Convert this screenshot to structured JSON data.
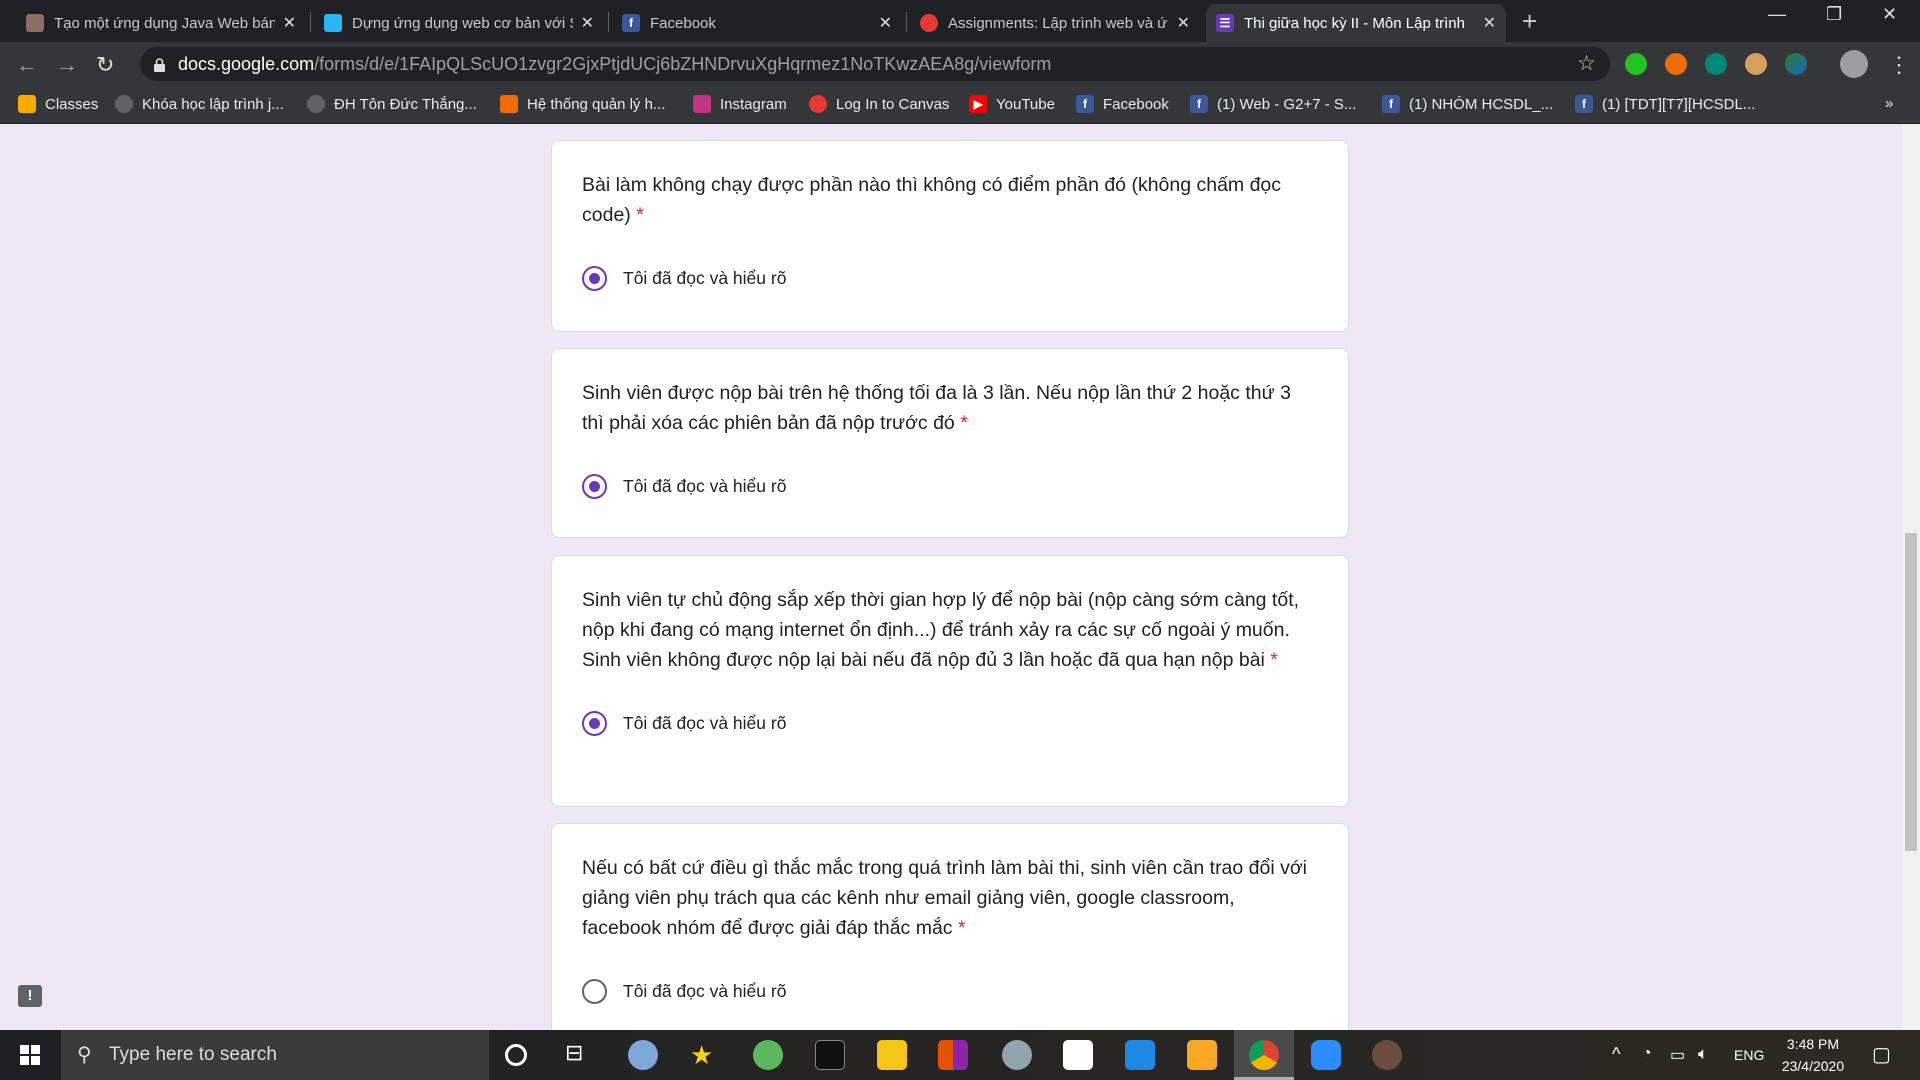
{
  "browser": {
    "tabs": [
      {
        "title": "Tạo một ứng dụng Java Web bán",
        "icon": "user-avatar-icon",
        "color": "#8d6e63",
        "active": false
      },
      {
        "title": "Dựng ứng dụng web cơ bản với S",
        "icon": "pin-icon",
        "color": "#29b6f6",
        "active": false
      },
      {
        "title": "Facebook",
        "icon": "facebook-icon",
        "color": "#3b5998",
        "active": false
      },
      {
        "title": "Assignments: Lập trình web và ứ",
        "icon": "canvas-icon",
        "color": "#e53935",
        "active": false
      },
      {
        "title": "Thi giữa học kỳ II - Môn Lập trình",
        "icon": "google-forms-icon",
        "color": "#673ab7",
        "active": true
      }
    ],
    "url_host": "docs.google.com",
    "url_path": "/forms/d/e/1FAIpQLScUO1zvgr2GjxPtjdUCj6bZHNDrvuXgHqrmez1NoTKwzAEA8g/viewform",
    "bookmarks": [
      {
        "label": "Classes",
        "icon": "classroom-icon",
        "color": "#f9ab00"
      },
      {
        "label": "Khóa học lập trình j...",
        "icon": "globe-icon",
        "color": "#5f6368"
      },
      {
        "label": "ĐH Tôn Đức Thắng...",
        "icon": "globe-icon",
        "color": "#5f6368"
      },
      {
        "label": "Hệ thống quản lý h...",
        "icon": "chart-icon",
        "color": "#ef6c00"
      },
      {
        "label": "Instagram",
        "icon": "instagram-icon",
        "color": "#c13584"
      },
      {
        "label": "Log In to Canvas",
        "icon": "canvas-icon",
        "color": "#e53935"
      },
      {
        "label": "YouTube",
        "icon": "youtube-icon",
        "color": "#ff0000"
      },
      {
        "label": "Facebook",
        "icon": "facebook-icon",
        "color": "#3b5998"
      },
      {
        "label": "(1) Web - G2+7 - S...",
        "icon": "facebook-icon",
        "color": "#3b5998"
      },
      {
        "label": "(1) NHÓM HCSDL_...",
        "icon": "facebook-icon",
        "color": "#3b5998"
      },
      {
        "label": "(1) [TDT][T7][HCSDL...",
        "icon": "facebook-icon",
        "color": "#3b5998"
      }
    ],
    "more_bookmarks": "»"
  },
  "form": {
    "accent": "#673ab7",
    "required_mark": "*",
    "questions": [
      {
        "text": "Bài làm không chạy được phần nào thì không có điểm phần đó (không chấm đọc code)",
        "option": "Tôi đã đọc và hiểu rõ",
        "selected": true
      },
      {
        "text": "Sinh viên được nộp bài trên hệ thống tối đa là 3 lần. Nếu nộp lần thứ 2 hoặc thứ 3 thì phải xóa các phiên bản đã nộp trước đó",
        "option": "Tôi đã đọc và hiểu rõ",
        "selected": true
      },
      {
        "text": "Sinh viên tự chủ động sắp xếp thời gian hợp lý để nộp bài (nộp càng sớm càng tốt, nộp khi đang có mạng internet ổn định...) để tránh xảy ra các sự cố ngoài ý muốn. Sinh viên không được nộp lại bài nếu đã nộp đủ 3 lần hoặc đã qua hạn nộp bài",
        "option": "Tôi đã đọc và hiểu rõ",
        "selected": true
      },
      {
        "text": "Nếu có bất cứ điều gì thắc mắc trong quá trình làm bài thi, sinh viên cần trao đổi với giảng viên phụ trách qua các kênh như email giảng viên, google classroom, facebook nhóm để được giải đáp thắc mắc",
        "option": "Tôi đã đọc và hiểu rõ",
        "selected": false
      }
    ],
    "feedback_icon": "!"
  },
  "taskbar": {
    "search_placeholder": "Type here to search",
    "language": "ENG",
    "time": "3:48 PM",
    "date": "23/4/2020"
  }
}
